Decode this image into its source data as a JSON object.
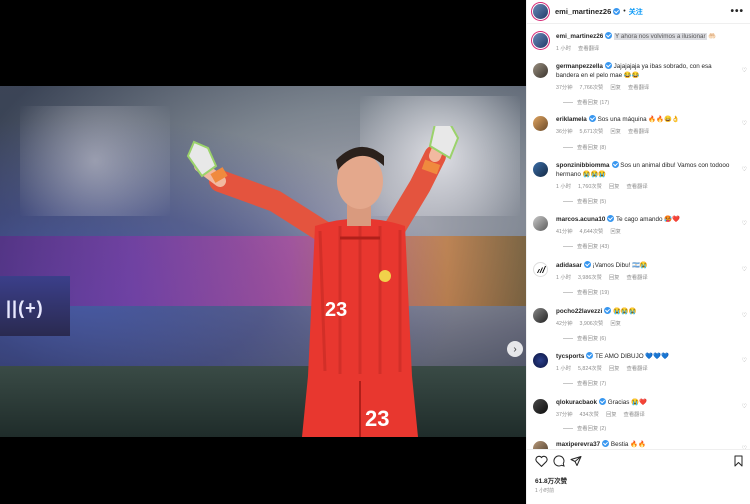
{
  "post": {
    "username": "emi_martinez26",
    "follow_label": "关注",
    "separator": "•",
    "more_label": "•••",
    "caption_user": "emi_martinez26",
    "caption_text": "Y ahora nos volvimos a ilusionar",
    "caption_emoji": "🤲🏻",
    "caption_time": "1 小时",
    "caption_translate": "查看翻译",
    "likes": "61.8万次赞",
    "posted_ago": "1 小时前",
    "jersey_number": "23",
    "screen_text": "||(+)"
  },
  "comments": [
    {
      "user": "germanpezzella",
      "text": "Jajajajaja ya ibas sobrado, con esa bandera en el pelo mae 😂😂",
      "time": "37分钟",
      "likes": "7,766次赞",
      "reply": "回复",
      "translate": "查看翻译",
      "replies": "查看回复 (17)"
    },
    {
      "user": "eriklamela",
      "text": "Sos una máquina 🔥🔥😄👌",
      "time": "36分钟",
      "likes": "5,671次赞",
      "reply": "回复",
      "translate": "查看翻译",
      "replies": "查看回复 (8)"
    },
    {
      "user": "sponzinibbiomma",
      "text": "Sos un animal dibu! Vamos con todooo hermano 😭😭😭",
      "time": "1 小时",
      "likes": "1,760次赞",
      "reply": "回复",
      "translate": "查看翻译",
      "replies": "查看回复 (5)"
    },
    {
      "user": "marcos.acuna10",
      "text": "Te cago amando 🥵❤️",
      "time": "41分钟",
      "likes": "4,644次赞",
      "reply": "回复",
      "translate": "",
      "replies": "查看回复 (43)"
    },
    {
      "user": "adidasar",
      "text": "¡Vamos Dibu! 🇦🇷😭",
      "time": "1 小时",
      "likes": "3,986次赞",
      "reply": "回复",
      "translate": "查看翻译",
      "replies": "查看回复 (19)"
    },
    {
      "user": "pocho22lavezzi",
      "text": "😭😭😭",
      "time": "42分钟",
      "likes": "3,906次赞",
      "reply": "回复",
      "translate": "",
      "replies": "查看回复 (6)"
    },
    {
      "user": "tycsports",
      "text": "TE AMO DIBUJO 💙💙💙",
      "time": "1 小时",
      "likes": "5,824次赞",
      "reply": "回复",
      "translate": "查看翻译",
      "replies": "查看回复 (7)"
    },
    {
      "user": "qlokuracbaok",
      "text": "Gracias 😭❤️",
      "time": "37分钟",
      "likes": "434次赞",
      "reply": "回复",
      "translate": "查看翻译",
      "replies": "查看回复 (2)"
    },
    {
      "user": "maxiperevra37",
      "text": "Bestia 🔥🔥",
      "time": "",
      "likes": "",
      "reply": "",
      "translate": "",
      "replies": ""
    }
  ],
  "colors": {
    "accent": "#0095f6",
    "verified": "#3897f0",
    "jersey": "#e8372f"
  },
  "icons": [
    "heart-icon",
    "comment-icon",
    "share-icon",
    "bookmark-icon",
    "chevron-right-icon"
  ]
}
